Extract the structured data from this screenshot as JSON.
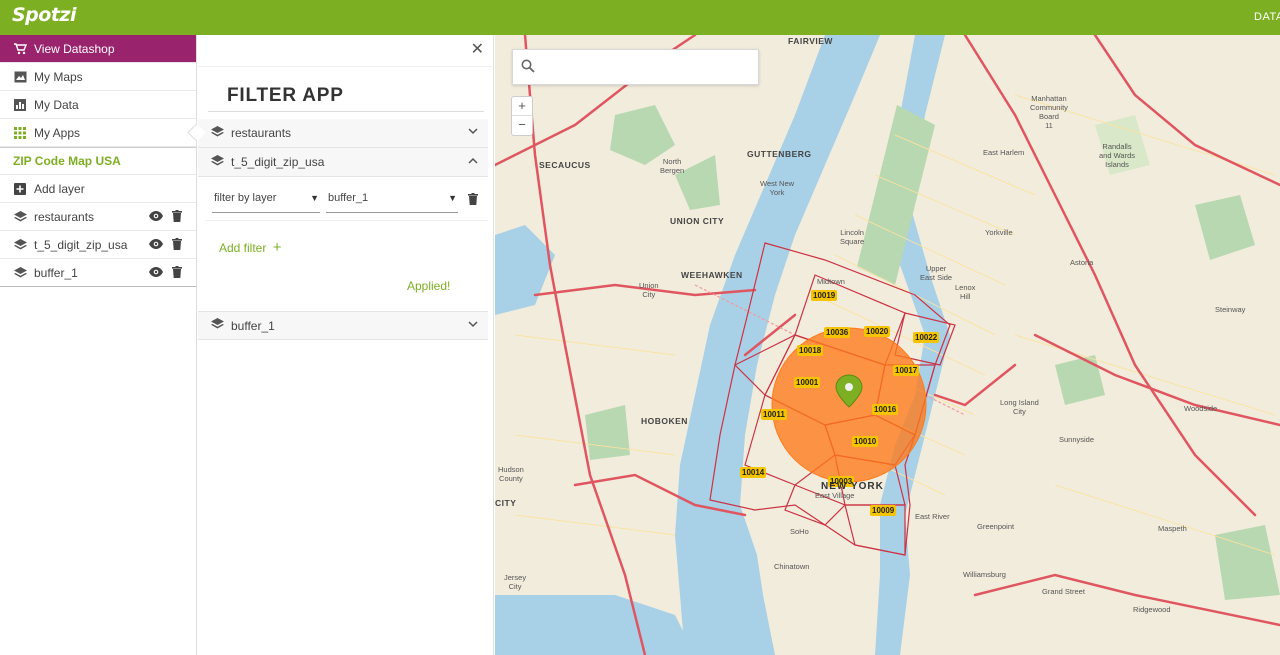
{
  "app": {
    "logo": "Spotzi",
    "topbar_right": "DATASHOP"
  },
  "sidebar": {
    "nav": [
      {
        "label": "View Datashop",
        "icon": "cart-icon"
      },
      {
        "label": "My Maps",
        "icon": "maps-icon"
      },
      {
        "label": "My Data",
        "icon": "chart-icon"
      },
      {
        "label": "My Apps",
        "icon": "apps-grid-icon"
      }
    ],
    "map_title": "ZIP Code Map USA",
    "add_layer": "Add layer",
    "layers": [
      {
        "label": "restaurants"
      },
      {
        "label": "t_5_digit_zip_usa"
      },
      {
        "label": "buffer_1"
      }
    ]
  },
  "filter_panel": {
    "title": "FILTER APP",
    "sections": [
      {
        "label": "restaurants",
        "expanded": false
      },
      {
        "label": "t_5_digit_zip_usa",
        "expanded": true
      },
      {
        "label": "buffer_1",
        "expanded": false
      }
    ],
    "filter_by_label": "filter by layer",
    "filter_layer_value": "buffer_1",
    "add_filter": "Add filter",
    "status": "Applied!"
  },
  "map": {
    "search_placeholder": "",
    "zoom_in": "+",
    "zoom_out": "−",
    "zip_labels": [
      "10019",
      "10036",
      "10020",
      "10022",
      "10018",
      "10017",
      "10001",
      "10016",
      "10011",
      "10010",
      "10014",
      "10003",
      "10009"
    ],
    "place_labels": {
      "fairview": "FAIRVIEW",
      "secaucus": "SECAUCUS",
      "guttenberg": "GUTTENBERG",
      "union_city": "UNION CITY",
      "weehawken": "WEEHAWKEN",
      "hoboken": "HOBOKEN",
      "new_york": "NEW YORK",
      "north_bergen": "North\nBergen",
      "west_new_york": "West New\nYork",
      "lincoln_square": "Lincoln\nSquare",
      "upper_east_side": "Upper\nEast Side",
      "east_harlem": "East Harlem",
      "yorkville": "Yorkville",
      "lenox_hill": "Lenox\nHill",
      "midtown": "Midtown",
      "astoria": "Astoria",
      "sunnyside": "Sunnyside",
      "greenpoint": "Greenpoint",
      "williamsburg": "Williamsburg",
      "east_village": "East Village",
      "chinatown": "Chinatown",
      "soho": "SoHo",
      "jersey_city": "Jersey\nCity",
      "union_city_small": "Union\nCity",
      "long_island_city": "Long Island\nCity",
      "woodside": "Woodside",
      "maspeth": "Maspeth",
      "grand_street": "Grand Street",
      "ridgewood": "Ridgewood",
      "east_river": "East River",
      "hudson_county": "Hudson\nCounty",
      "city": "CITY",
      "randalls": "Randalls\nand Wards\nIslands",
      "manhattan_cb": "Manhattan\nCommunity\nBoard\n11",
      "steinway": "Steinway"
    }
  }
}
